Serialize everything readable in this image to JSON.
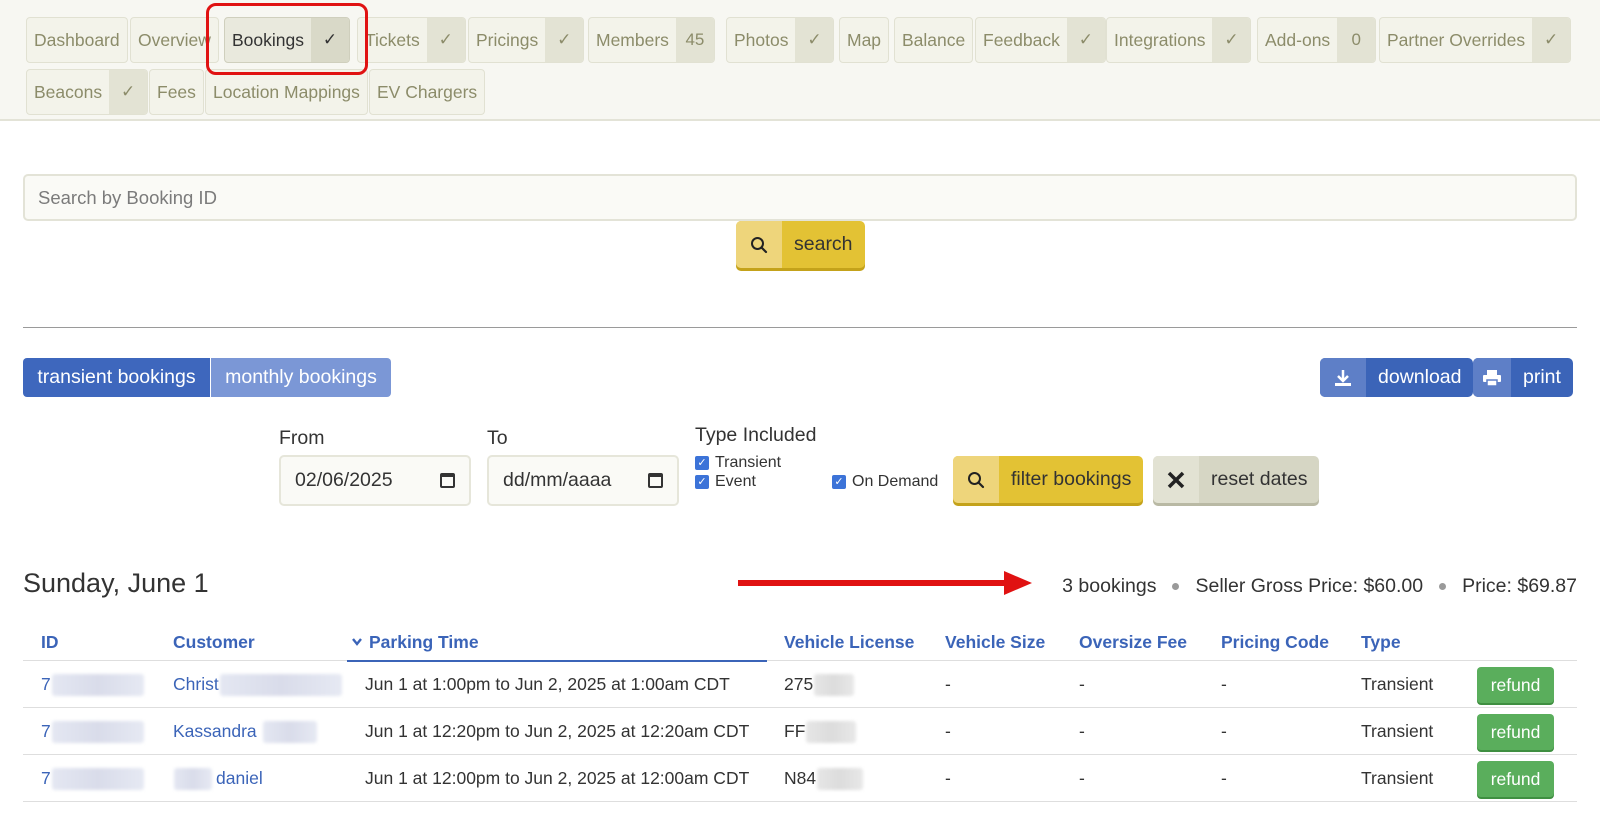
{
  "tabs": [
    {
      "label": "Dashboard",
      "badge": null
    },
    {
      "label": "Overview",
      "badge": null
    },
    {
      "label": "Bookings",
      "badge": "✓",
      "active": true
    },
    {
      "label": "Tickets",
      "badge": "✓"
    },
    {
      "label": "Pricings",
      "badge": "✓"
    },
    {
      "label": "Members",
      "badge": "45"
    },
    {
      "label": "Photos",
      "badge": "✓"
    },
    {
      "label": "Map",
      "badge": null
    },
    {
      "label": "Balance",
      "badge": null
    },
    {
      "label": "Feedback",
      "badge": "✓"
    },
    {
      "label": "Integrations",
      "badge": "✓"
    },
    {
      "label": "Add-ons",
      "badge": "0"
    },
    {
      "label": "Partner Overrides",
      "badge": "✓"
    },
    {
      "label": "Beacons",
      "badge": "✓"
    },
    {
      "label": "Fees",
      "badge": null
    },
    {
      "label": "Location Mappings",
      "badge": null
    },
    {
      "label": "EV Chargers",
      "badge": null
    }
  ],
  "search": {
    "placeholder": "Search by Booking ID",
    "button_label": "search",
    "icon": "search-icon"
  },
  "booking_types": {
    "transient_label": "transient bookings",
    "monthly_label": "monthly bookings"
  },
  "actions": {
    "download_label": "download",
    "print_label": "print"
  },
  "filters": {
    "from_label": "From",
    "from_value": "02/06/2025",
    "to_label": "To",
    "to_value": "dd/mm/aaaa",
    "type_label": "Type Included",
    "types": [
      {
        "label": "Transient",
        "checked": true
      },
      {
        "label": "Event",
        "checked": true
      },
      {
        "label": "On Demand",
        "checked": true
      }
    ],
    "filter_label": "filter bookings",
    "reset_label": "reset dates"
  },
  "day": {
    "title": "Sunday, June 1",
    "bookings_count": "3 bookings",
    "seller_gross": "Seller Gross Price: $60.00",
    "price": "Price: $69.87"
  },
  "table": {
    "columns": [
      "ID",
      "Customer",
      "Parking Time",
      "Vehicle License",
      "Vehicle Size",
      "Oversize Fee",
      "Pricing Code",
      "Type"
    ],
    "sorted_column": "Parking Time",
    "rows": [
      {
        "id": "7",
        "customer": "Christ",
        "time": "Jun 1 at 1:00pm to Jun 2, 2025 at 1:00am CDT",
        "license": "275",
        "size": "-",
        "oversize": "-",
        "pricing_code": "-",
        "type": "Transient",
        "action": "refund"
      },
      {
        "id": "7",
        "customer": "Kassandra",
        "time": "Jun 1 at 12:20pm to Jun 2, 2025 at 12:20am CDT",
        "license": "FF",
        "size": "-",
        "oversize": "-",
        "pricing_code": "-",
        "type": "Transient",
        "action": "refund"
      },
      {
        "id": "7",
        "customer": "daniel",
        "time": "Jun 1 at 12:00pm to Jun 2, 2025 at 12:00am CDT",
        "license": "N84",
        "size": "-",
        "oversize": "-",
        "pricing_code": "-",
        "type": "Transient",
        "action": "refund"
      }
    ]
  },
  "colors": {
    "accent_blue": "#3b64b8",
    "yellow": "#e3c234",
    "green": "#5aae5c",
    "highlight_red": "#e01212"
  }
}
